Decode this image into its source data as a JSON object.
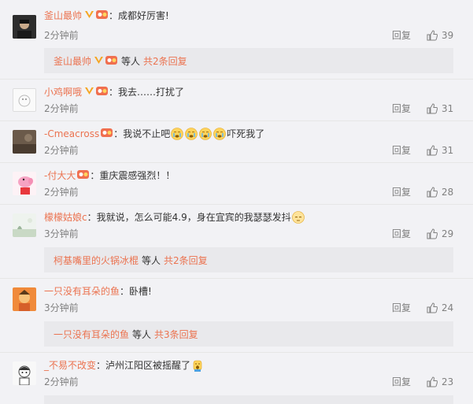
{
  "labels": {
    "reply": "回复",
    "etc": "等人",
    "colon": "："
  },
  "colors": {
    "username": "#eb7350",
    "time": "#808080",
    "badge_gold": "#f5a623",
    "level_badge": "#f06f4f"
  },
  "comments": [
    {
      "username": "釜山最帅",
      "verified": true,
      "text": "成都好厉害!",
      "time": "2分钟前",
      "likes": "39",
      "avatar_icon": "avatar-person-dark",
      "sub": {
        "username": "釜山最帅",
        "verified": true,
        "total": "共2条回复"
      }
    },
    {
      "username": "小鸡啊哦",
      "verified": true,
      "text": "我去……打扰了",
      "time": "2分钟前",
      "likes": "31",
      "avatar_icon": "avatar-cartoon-chick"
    },
    {
      "username": "-Cmeacross",
      "verified": false,
      "text_before": "我说不止吧",
      "emoji": "crying-emoji",
      "emoji_count": 4,
      "text_after": "吓死我了",
      "time": "2分钟前",
      "likes": "31",
      "avatar_icon": "avatar-photo-dark"
    },
    {
      "username": "-付大大",
      "verified": false,
      "text": "重庆震感强烈！！",
      "time": "2分钟前",
      "likes": "28",
      "avatar_icon": "avatar-peppa-pig"
    },
    {
      "username": "檬檬姑娘c",
      "verified": false,
      "text": "我就说，怎么可能4.9，身在宜宾的我瑟瑟发抖",
      "emoji_after": "shiver-emoji",
      "time": "3分钟前",
      "likes": "29",
      "avatar_icon": "avatar-landscape",
      "sub": {
        "username": "柯基嘴里的火锅冰棍",
        "verified": false,
        "total": "共2条回复"
      }
    },
    {
      "username": "一只没有耳朵的鱼",
      "verified": false,
      "text": "卧槽!",
      "time": "3分钟前",
      "likes": "24",
      "avatar_icon": "avatar-cartoon-orange",
      "sub": {
        "username": "一只没有耳朵的鱼",
        "verified": false,
        "total": "共3条回复"
      }
    },
    {
      "username": "_不易不改变",
      "verified": false,
      "text": "泸州江阳区被摇醒了",
      "emoji_after": "yawn-emoji",
      "time": "2分钟前",
      "likes": "23",
      "avatar_icon": "avatar-cartoon-boy"
    }
  ]
}
